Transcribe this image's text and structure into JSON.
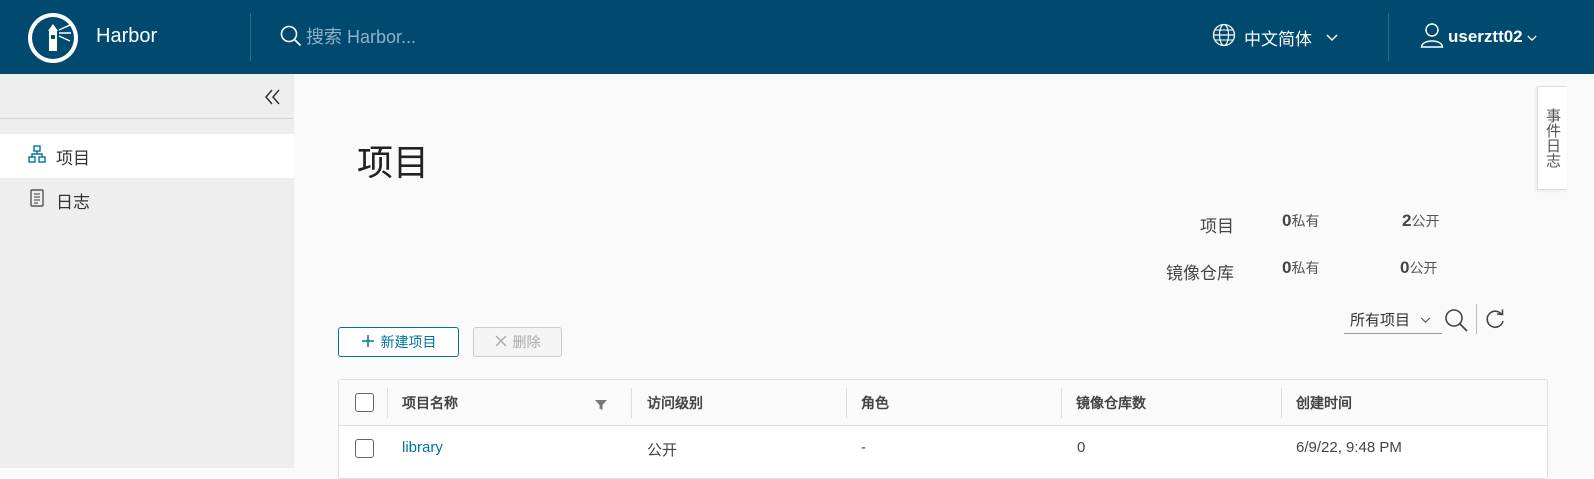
{
  "header": {
    "brand": "Harbor",
    "search_placeholder": "搜索 Harbor...",
    "language": "中文简体",
    "username": "userztt02"
  },
  "sidebar": {
    "items": [
      {
        "label": "项目",
        "icon": "projects-icon",
        "active": true
      },
      {
        "label": "日志",
        "icon": "logs-icon",
        "active": false
      }
    ]
  },
  "main": {
    "title": "项目",
    "event_log_tab": "事件日志",
    "stats": {
      "projects_label": "项目",
      "repos_label": "镜像仓库",
      "projects_private": "0",
      "projects_public": "2",
      "repos_private": "0",
      "repos_public": "0",
      "private_unit": "私有",
      "public_unit": "公开"
    },
    "toolbar": {
      "new_project": "新建项目",
      "delete": "删除",
      "filter_value": "所有项目"
    },
    "table": {
      "columns": [
        "项目名称",
        "访问级别",
        "角色",
        "镜像仓库数",
        "创建时间"
      ],
      "rows": [
        {
          "name": "library",
          "access": "公开",
          "role": "-",
          "repo_count": "0",
          "created": "6/9/22, 9:48 PM"
        }
      ]
    }
  },
  "colors": {
    "header_bg": "#004a70",
    "accent": "#0072a3",
    "sidebar_bg": "#eeeeee"
  }
}
